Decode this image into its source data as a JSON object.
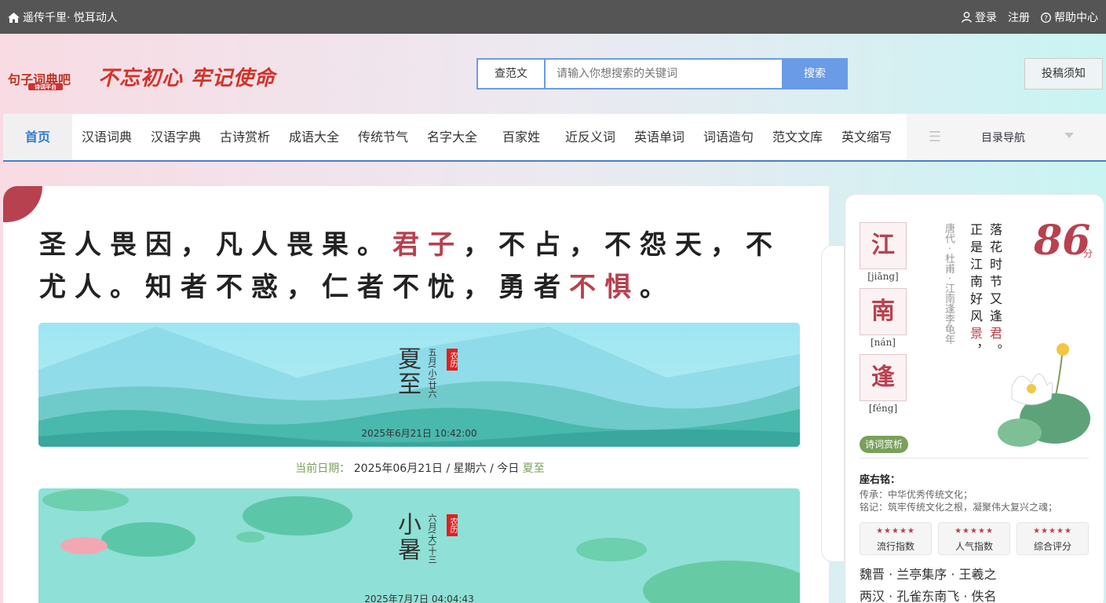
{
  "topbar": {
    "site_slogan": "遥传千里· 悦耳动人",
    "login": "登录",
    "register": "注册",
    "help": "帮助中心"
  },
  "header": {
    "logo_text": "句子词典吧",
    "logo_sub": "诗词平台",
    "slogan": "不忘初心 牢记使命",
    "search_type": "查范文",
    "search_placeholder": "请输入你想搜索的关键词",
    "search_button": "搜索",
    "submit_button": "投稿须知"
  },
  "nav": {
    "items": [
      "首页",
      "汉语词典",
      "汉语字典",
      "古诗赏析",
      "成语大全",
      "传统节气",
      "名字大全",
      "百家姓",
      "近反义词",
      "英语单词",
      "词语造句",
      "范文文库",
      "英文缩写"
    ],
    "menu_label": "目录导航"
  },
  "quote": {
    "part1": "圣人畏因，凡人畏果。",
    "red1": "君子",
    "part2": "，不占，不怨天，不尤人。知者不惑，仁者不忧，勇者",
    "red2": "不惧",
    "part3": "。"
  },
  "banner1": {
    "term": "夏至",
    "lunar": "五月(小)廿六",
    "stamp": "农历",
    "time": "2025年6月21日 10:42:00"
  },
  "current_date": {
    "label": "当前日期：",
    "value": "2025年06月21日 / 星期六 / 今日",
    "term": "夏至"
  },
  "banner2": {
    "term": "小暑",
    "lunar": "六月(大)十三",
    "stamp": "农历",
    "time": "2025年7月7日 04:04:43"
  },
  "poem": {
    "chars": [
      {
        "char": "江",
        "pinyin": "[jiāng]"
      },
      {
        "char": "南",
        "pinyin": "[nán]"
      },
      {
        "char": "逢",
        "pinyin": "[féng]"
      }
    ],
    "author": "唐代 · 杜甫 · 江南逢李龟年",
    "line1": "落花时节又逢",
    "line1_red": "君",
    "line1_end": "。",
    "line2": "正是江南好风",
    "line2_red": "景",
    "line2_end": "，",
    "score": "86",
    "score_unit": "分",
    "tag": "诗词赏析"
  },
  "motto": {
    "title": "座右铭：",
    "line1": "传承：中华优秀传统文化；",
    "line2": "铭记：筑牢传统文化之根，凝聚伟大复兴之魂；"
  },
  "stats": [
    {
      "stars": "★★★★★",
      "label": "流行指数"
    },
    {
      "stars": "★★★★★",
      "label": "人气指数"
    },
    {
      "stars": "★★★★★",
      "label": "综合评分"
    }
  ],
  "refs": [
    "魏晋 · 兰亭集序 · 王羲之",
    "两汉 · 孔雀东南飞 · 佚名"
  ]
}
